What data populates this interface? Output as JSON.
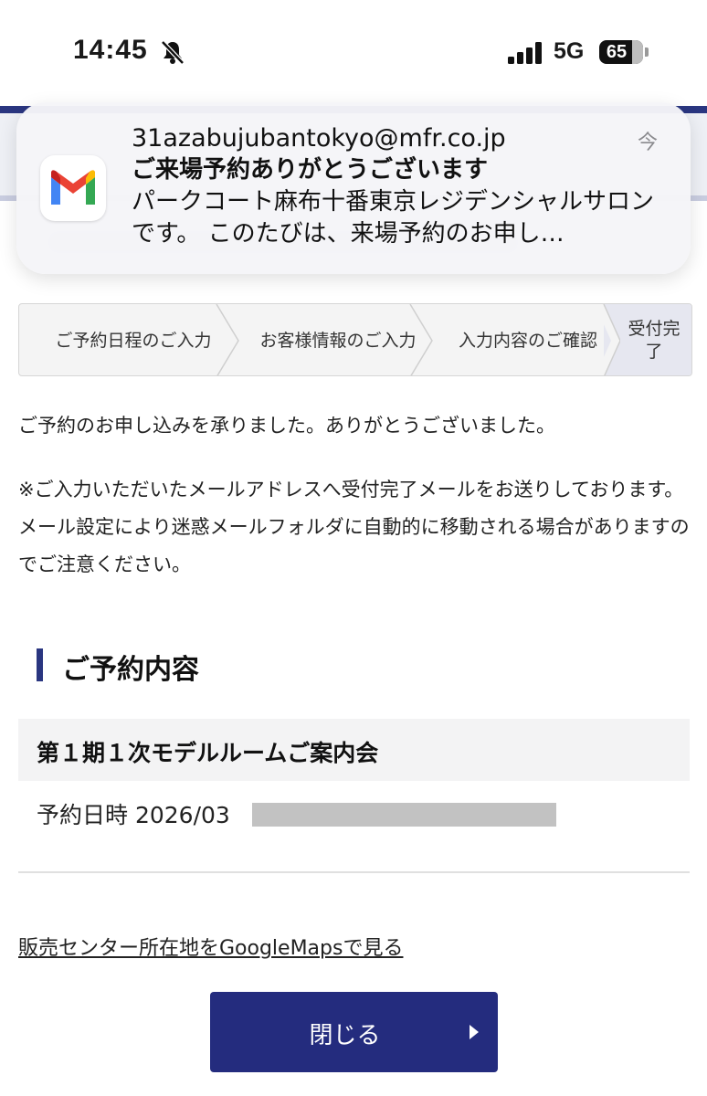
{
  "status_bar": {
    "time": "14:45",
    "network": "5G",
    "battery": "65"
  },
  "notification": {
    "app_icon": "gmail-icon",
    "sender": "31azabujubantokyo@mfr.co.jp",
    "subject": "ご来場予約ありがとうございます",
    "body": "パークコート麻布十番東京レジデンシャルサロンです。 このたびは、来場予約のお申し…",
    "time": "今"
  },
  "stepper": {
    "steps": [
      {
        "label": "ご予約日程のご入力",
        "active": false
      },
      {
        "label": "お客様情報のご入力",
        "active": false
      },
      {
        "label": "入力内容のご確認",
        "active": false
      },
      {
        "label": "受付完了",
        "active": true
      }
    ]
  },
  "main": {
    "thanks": "ご予約のお申し込みを承りました。ありがとうございました。",
    "notice_1": "※ご入力いただいたメールアドレスへ受付完了メールをお送りしております。",
    "notice_2": "メール設定により迷惑メールフォルダに自動的に移動される場合がありますのでご注意ください。",
    "section_title": "ご予約内容",
    "event_name": "第１期１次モデルルームご案内会",
    "reservation_datetime": "予約日時 2026/03",
    "maps_link": "販売センター所在地をGoogleMapsで見る",
    "close_button": "閉じる"
  },
  "colors": {
    "accent": "#242c7e",
    "active_step": "#e6e7f0"
  }
}
